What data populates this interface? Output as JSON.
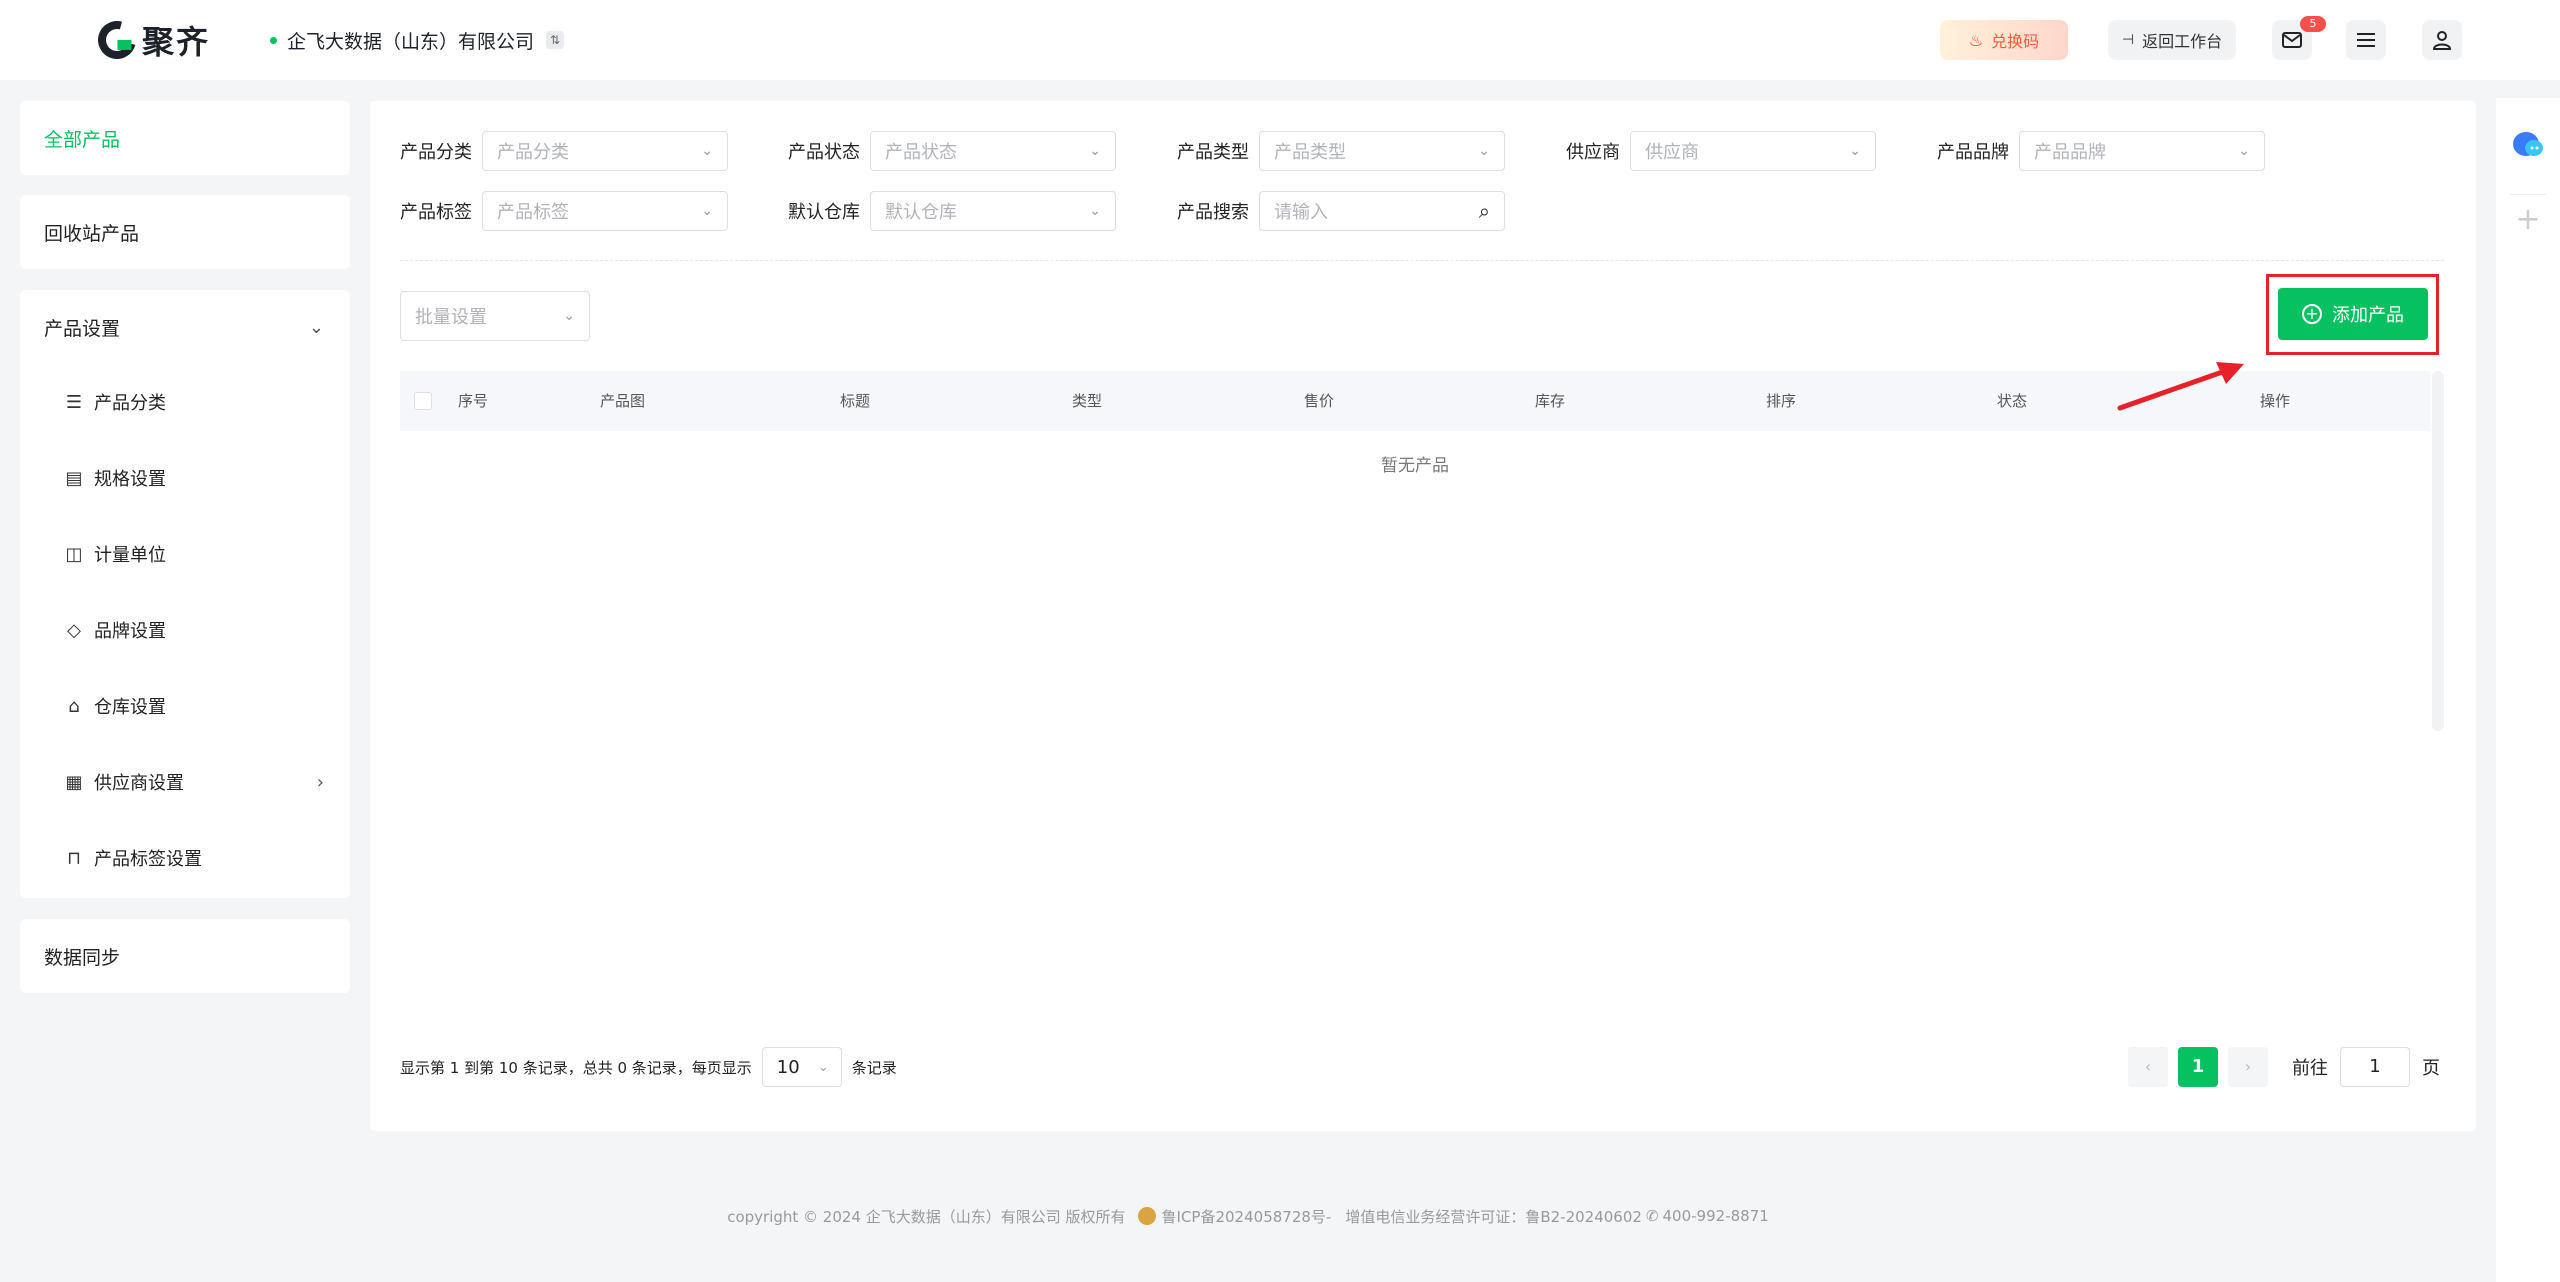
{
  "header": {
    "logo_text": "聚齐",
    "company_name": "企飞大数据（山东）有限公司",
    "company_switch_icon": "switch-icon",
    "redeem_label": "兑换码",
    "back_label": "返回工作台",
    "mail_badge": "5"
  },
  "sidebar": {
    "all_products": "全部产品",
    "recycle": "回收站产品",
    "settings_group": "产品设置",
    "settings_items": [
      {
        "label": "产品分类",
        "icon": "list-icon"
      },
      {
        "label": "规格设置",
        "icon": "spec-icon"
      },
      {
        "label": "计量单位",
        "icon": "unit-icon"
      },
      {
        "label": "品牌设置",
        "icon": "tag-icon"
      },
      {
        "label": "仓库设置",
        "icon": "warehouse-icon"
      },
      {
        "label": "供应商设置",
        "icon": "building-icon"
      },
      {
        "label": "产品标签设置",
        "icon": "bookmark-icon"
      }
    ],
    "data_sync": "数据同步"
  },
  "filters": [
    {
      "label": "产品分类",
      "placeholder": "产品分类"
    },
    {
      "label": "产品状态",
      "placeholder": "产品状态"
    },
    {
      "label": "产品类型",
      "placeholder": "产品类型"
    },
    {
      "label": "供应商",
      "placeholder": "供应商"
    },
    {
      "label": "产品品牌",
      "placeholder": "产品品牌"
    },
    {
      "label": "产品标签",
      "placeholder": "产品标签"
    },
    {
      "label": "默认仓库",
      "placeholder": "默认仓库"
    },
    {
      "label": "产品搜索",
      "placeholder": "请输入"
    }
  ],
  "toolbar": {
    "batch_label": "批量设置",
    "add_label": "添加产品"
  },
  "table": {
    "columns": [
      "序号",
      "产品图",
      "标题",
      "类型",
      "售价",
      "库存",
      "排序",
      "状态",
      "操作"
    ],
    "empty_text": "暂无产品"
  },
  "pagination": {
    "info": "显示第 1 到第 10 条记录，总共 0 条记录，每页显示",
    "page_size": "10",
    "suffix": "条记录",
    "current_page": "1",
    "prev": "‹",
    "next": "›",
    "goto_label": "前往",
    "goto_value": "1",
    "page_unit": "页"
  },
  "footer": {
    "copyright": "copyright © 2024 企飞大数据（山东）有限公司 版权所有",
    "icp": "鲁ICP备2024058728号-",
    "license": "增值电信业务经营许可证：鲁B2-20240602",
    "phone": "400-992-8871"
  },
  "colors": {
    "accent": "#07c160",
    "annotation": "#e6212a"
  }
}
